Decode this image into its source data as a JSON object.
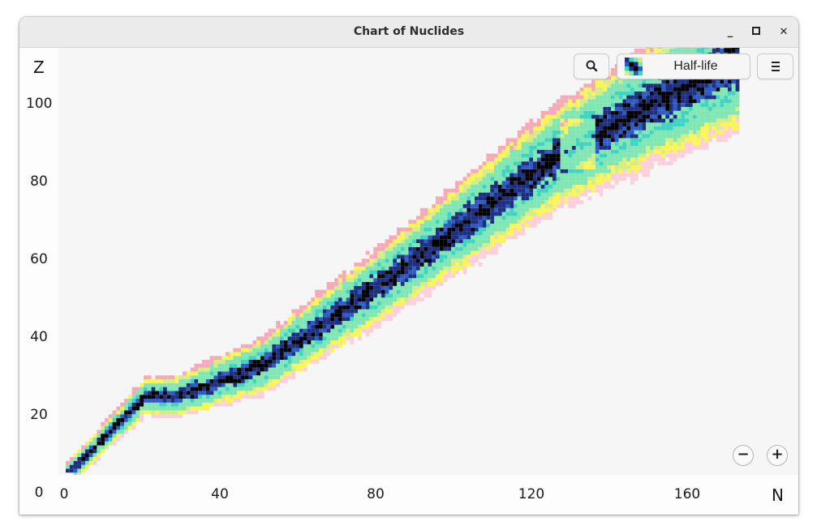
{
  "window": {
    "title": "Chart of Nuclides",
    "minimize_glyph": "_",
    "maximize_glyph": "□",
    "close_glyph": "✕"
  },
  "header": {
    "search_icon": "search-icon",
    "mode_label": "Half-life",
    "menu_icon": "hamburger-menu-icon"
  },
  "axes": {
    "y_label": "Z",
    "x_label": "N",
    "y_ticks": [
      "100",
      "80",
      "60",
      "40",
      "20",
      "0"
    ],
    "x_ticks": [
      "0",
      "40",
      "80",
      "120",
      "160"
    ]
  },
  "zoom": {
    "out_glyph": "−",
    "in_glyph": "+"
  },
  "colors": {
    "stable": "#000000",
    "very_long": "#1e2f80",
    "long": "#2f5bc4",
    "medium": "#7fe6b4",
    "teal": "#3fd3c4",
    "short": "#d6ec84",
    "very_short": "#fbf55a",
    "unknown_p": "#f8a8b8",
    "unknown_n": "#fbd0dc"
  }
}
